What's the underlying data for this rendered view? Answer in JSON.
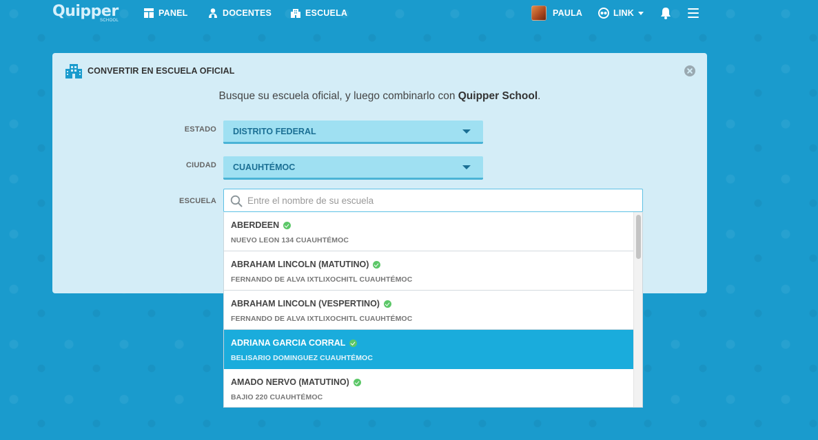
{
  "topbar": {
    "logo_text": "Quipper",
    "logo_sub": "SCHOOL",
    "nav": {
      "panel": "PANEL",
      "docentes": "DOCENTES",
      "escuela": "ESCUELA"
    },
    "user_name": "PAULA",
    "link_label": "LINK",
    "icons": [
      "panel-icon",
      "docentes-icon",
      "escuela-icon",
      "link-icon",
      "bell-icon",
      "menu-icon"
    ]
  },
  "modal": {
    "title": "CONVERTIR EN ESCUELA OFICIAL",
    "intro_prefix": "Busque su escuela oficial, y luego combinarlo con ",
    "intro_brand": "Quipper School",
    "intro_suffix": ".",
    "estado": {
      "label": "ESTADO",
      "value": "DISTRITO FEDERAL"
    },
    "ciudad": {
      "label": "CIUDAD",
      "value": "CUAUHTÉMOC"
    },
    "escuela": {
      "label": "ESCUELA",
      "placeholder": "Entre el nombre de su escuela",
      "value": ""
    }
  },
  "dropdown": {
    "items": [
      {
        "name": "ABERDEEN",
        "address": "NUEVO LEON 134 CUAUHTÉMOC",
        "verified": true,
        "selected": false
      },
      {
        "name": "ABRAHAM LINCOLN (MATUTINO)",
        "address": "FERNANDO DE ALVA IXTLIXOCHITL CUAUHTÉMOC",
        "verified": true,
        "selected": false
      },
      {
        "name": "ABRAHAM LINCOLN (VESPERTINO)",
        "address": "FERNANDO DE ALVA IXTLIXOCHITL CUAUHTÉMOC",
        "verified": true,
        "selected": false
      },
      {
        "name": "ADRIANA GARCIA CORRAL",
        "address": "BELISARIO DOMINGUEZ CUAUHTÉMOC",
        "verified": true,
        "selected": true
      },
      {
        "name": "AMADO NERVO (MATUTINO)",
        "address": "BAJIO 220 CUAUHTÉMOC",
        "verified": true,
        "selected": false
      }
    ]
  },
  "colors": {
    "background": "#1a9bcd",
    "card": "#d4edf7",
    "select_fill": "#9fe0f2",
    "selected_row": "#1aacdc",
    "verified_check": "#5cc768"
  }
}
